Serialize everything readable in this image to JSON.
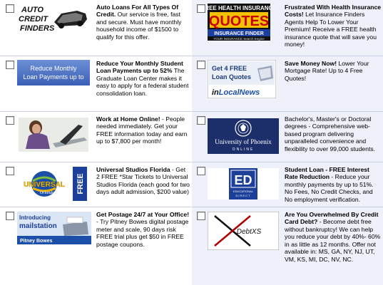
{
  "ads": [
    {
      "logo": {
        "lines": [
          "AUTO",
          "CREDIT",
          "FINDERS"
        ]
      },
      "headline": "Auto Loans For All Types Of Credit.",
      "body": " Our service is free, fast and secure. Must have monthly household income of $1500 to qualify for this offer."
    },
    {
      "logo": {
        "top": "FREE HEALTH INSURANCE",
        "mid": "QUOTES",
        "bar": "INSURANCE FINDER",
        "small": "YOUR INSURANCE Search Engine"
      },
      "headline": "Frustrated With Health Insurance Costs!",
      "body": " Let Insurance Finders Agents Help To Lower Your Premium! Receive a FREE health insurance quote that will save you money!"
    },
    {
      "logo": {
        "lines": [
          "Reduce Monthly",
          "Loan Payments up to"
        ]
      },
      "headline": "Reduce Your Monthly Student Loan Payments up to 52%",
      "body": " The Graduate Loan Center makes it easy to apply for a federal student consolidation loan."
    },
    {
      "logo": {
        "lines": [
          "Get 4 FREE",
          "Loan Quotes"
        ],
        "brand_a": "in",
        "brand_b": "LocalNews"
      },
      "headline": "Save Money Now!",
      "body": " Lower Your Mortgage Rate! Up to 4 Free Quotes!"
    },
    {
      "logo": {},
      "headline": "Work at Home Online!",
      "body": " - People needed immediately. Get your FREE information today and earn up to $7,800 per month!"
    },
    {
      "logo": {
        "line1": "University of Phoenix",
        "line2": "ONLINE"
      },
      "headline": "",
      "body": "Bachelor's, Master's or Doctoral degrees - Comprehensive web-based program delivering unparalleled convenience and flexibility to over 99,000 students."
    },
    {
      "logo": {
        "name": "UNIVERSAL",
        "sub": "Orlando",
        "side": "FREE"
      },
      "headline": "Universal Studios Florida",
      "body": " - Get 2 FREE *Star Tickets to Universal Studios Florida (each good for two days adult admission, $200 value)"
    },
    {
      "logo": {
        "big": "ED",
        "sub1": "EDUCATIONAL",
        "sub2": "DIRECT"
      },
      "headline": "Student Loan - FREE Interest Rate Reduction",
      "body": " - Reduce your monthly payments by up to 51%. No Fees, No Credit Checks, and No employment verification."
    },
    {
      "logo": {
        "lines": [
          "Introducing",
          "mailstation"
        ],
        "brand": "Pitney Bowes"
      },
      "headline": "Get Postage 24/7 at Your Office!",
      "body": " - Try Pitney Bowes digital postage meter and scale, 90 days risk FREE trial plus get $50 in FREE postage coupons."
    },
    {
      "logo": {
        "text": "DebtXS"
      },
      "headline": "Are You Overwhelmed By Credit Card Debt?",
      "body": " - Become debt free without bankruptcy! We can help you reduce your debt by 40%- 60% in as little as 12 months. Offer not available in: MS, GA, NY, NJ, UT, VM, KS, MI, DC, NV, NC."
    }
  ]
}
